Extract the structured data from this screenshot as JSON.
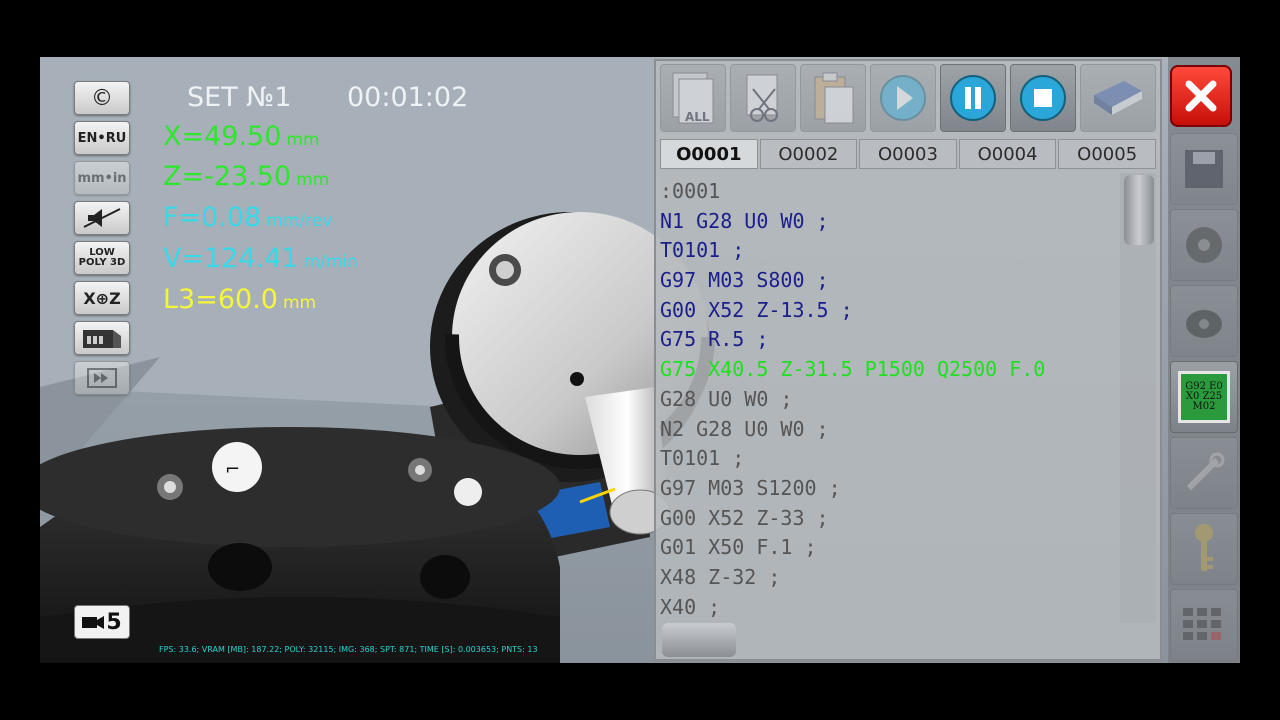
{
  "hud": {
    "set_label": "SET №1",
    "timer": "00:01:02",
    "x": {
      "value": "X=49.50",
      "unit": "mm"
    },
    "z": {
      "value": "Z=-23.50",
      "unit": "mm"
    },
    "f": {
      "value": "F=0.08",
      "unit": "mm/rev"
    },
    "v": {
      "value": "V=124.41",
      "unit": "m/min"
    },
    "l3": {
      "value": "L3=60.0",
      "unit": "mm"
    },
    "stats": "FPS: 33.6; VRAM [MB]: 187.22; POLY: 32115; IMG: 368; SPT: 871; TIME [S]: 0.003653; PNTS: 13"
  },
  "left_tools": [
    {
      "label": "©",
      "icon": "copyright-icon"
    },
    {
      "label": "EN•RU",
      "icon": "language-toggle-icon"
    },
    {
      "label": "mm•in",
      "icon": "units-toggle-icon"
    },
    {
      "label": "",
      "icon": "mute-icon"
    },
    {
      "label": "LOW POLY 3D",
      "icon": "low-poly-3d-icon"
    },
    {
      "label": "X⊕Z",
      "icon": "axis-icon"
    },
    {
      "label": "",
      "icon": "machine-view-icon"
    },
    {
      "label": "",
      "icon": "fast-forward-icon"
    }
  ],
  "camera": {
    "label": "5"
  },
  "editor": {
    "tabs": [
      "O0001",
      "O0002",
      "O0003",
      "O0004",
      "O0005"
    ],
    "active_tab": 0,
    "lines": [
      ":0001",
      "N1 G28 U0 W0 ;",
      "T0101 ;",
      "G97 M03 S800 ;",
      "G00 X52 Z-13.5 ;",
      "G75 R.5 ;",
      "G75 X40.5 Z-31.5 P1500 Q2500 F.0",
      "G28 U0 W0 ;",
      "N2 G28 U0 W0 ;",
      "T0101 ;",
      "G97 M03 S1200 ;",
      "G00 X52 Z-33 ;",
      "G01 X50 F.1 ;",
      "X48 Z-32 ;",
      "X40 ;"
    ],
    "active_line": 6,
    "toolbar": [
      "select-all-icon",
      "cut-icon",
      "paste-icon",
      "play-icon",
      "pause-icon",
      "stop-icon",
      "book-icon"
    ],
    "select_all_label": "ALL"
  },
  "right_panel": {
    "gcode_button_text": "G92 E0 X0 Z25 M02",
    "icons": [
      "floppy-icon",
      "chuck-icon",
      "tool-holder-icon",
      "gcode-icon",
      "wrench-icon",
      "key-icon",
      "calculator-icon"
    ]
  },
  "colors": {
    "x": "#2fe62f",
    "z": "#2fe62f",
    "f": "#38d8e8",
    "v": "#38d8e8",
    "l3": "#f5f53a",
    "active_code": "#1fe01f",
    "code": "#1b1f8a"
  }
}
